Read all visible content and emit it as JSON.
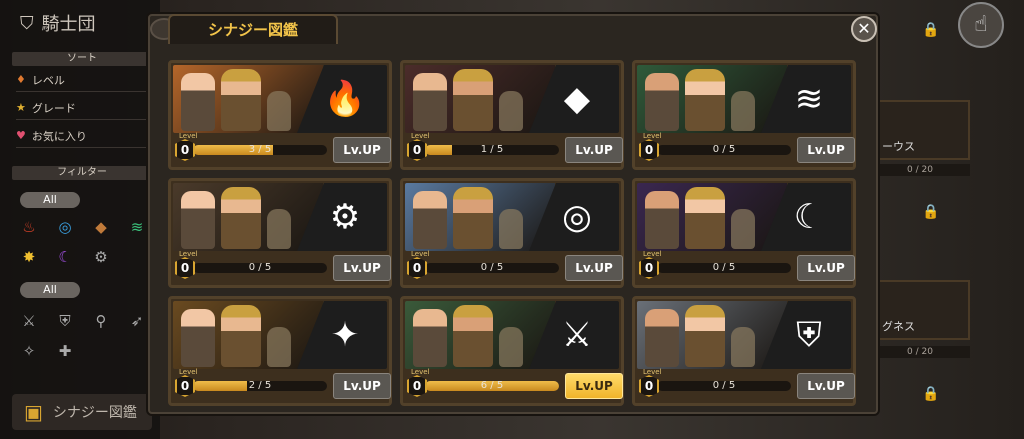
{
  "side": {
    "title": "騎士団",
    "sort_header": "ソート",
    "sort_items": [
      "レベル",
      "グレード",
      "お気に入り"
    ],
    "filter_header": "フィルター",
    "filter_all_1": "All",
    "filter_all_2": "All",
    "synergy_button": "シナジー図鑑"
  },
  "right": {
    "cards": [
      {
        "label": "ーウス",
        "count": "0 / 20"
      },
      {
        "label": "グネス",
        "count": "0 / 20"
      }
    ]
  },
  "modal": {
    "tab_title": "シナジー図鑑",
    "close_icon": "close-icon",
    "level_label": "Level",
    "lvup_label": "Lv.UP",
    "cards": [
      {
        "element": "fire",
        "icon": "🔥",
        "level": "0",
        "progress": "3 / 5",
        "fraction": 0.6,
        "active": false,
        "bg": "#b5662a"
      },
      {
        "element": "earth",
        "icon": "◆",
        "level": "0",
        "progress": "1 / 5",
        "fraction": 0.2,
        "active": false,
        "bg": "#4b2c2a"
      },
      {
        "element": "wind",
        "icon": "≋",
        "level": "0",
        "progress": "0 / 5",
        "fraction": 0.0,
        "active": false,
        "bg": "#2f5a3a"
      },
      {
        "element": "mechanic",
        "icon": "⚙",
        "level": "0",
        "progress": "0 / 5",
        "fraction": 0.0,
        "active": false,
        "bg": "#4a3a2a"
      },
      {
        "element": "water",
        "icon": "◎",
        "level": "0",
        "progress": "0 / 5",
        "fraction": 0.0,
        "active": false,
        "bg": "#5a7aa0"
      },
      {
        "element": "dark",
        "icon": "☾",
        "level": "0",
        "progress": "0 / 5",
        "fraction": 0.0,
        "active": false,
        "bg": "#3a2750"
      },
      {
        "element": "light",
        "icon": "✦",
        "level": "0",
        "progress": "2 / 5",
        "fraction": 0.4,
        "active": false,
        "bg": "#6a4a20"
      },
      {
        "element": "sword",
        "icon": "⚔",
        "level": "0",
        "progress": "6 / 5",
        "fraction": 1.0,
        "active": true,
        "bg": "#3a5a3a"
      },
      {
        "element": "shield",
        "icon": "⛨",
        "level": "0",
        "progress": "0 / 5",
        "fraction": 0.0,
        "active": false,
        "bg": "#6a7078"
      }
    ]
  }
}
